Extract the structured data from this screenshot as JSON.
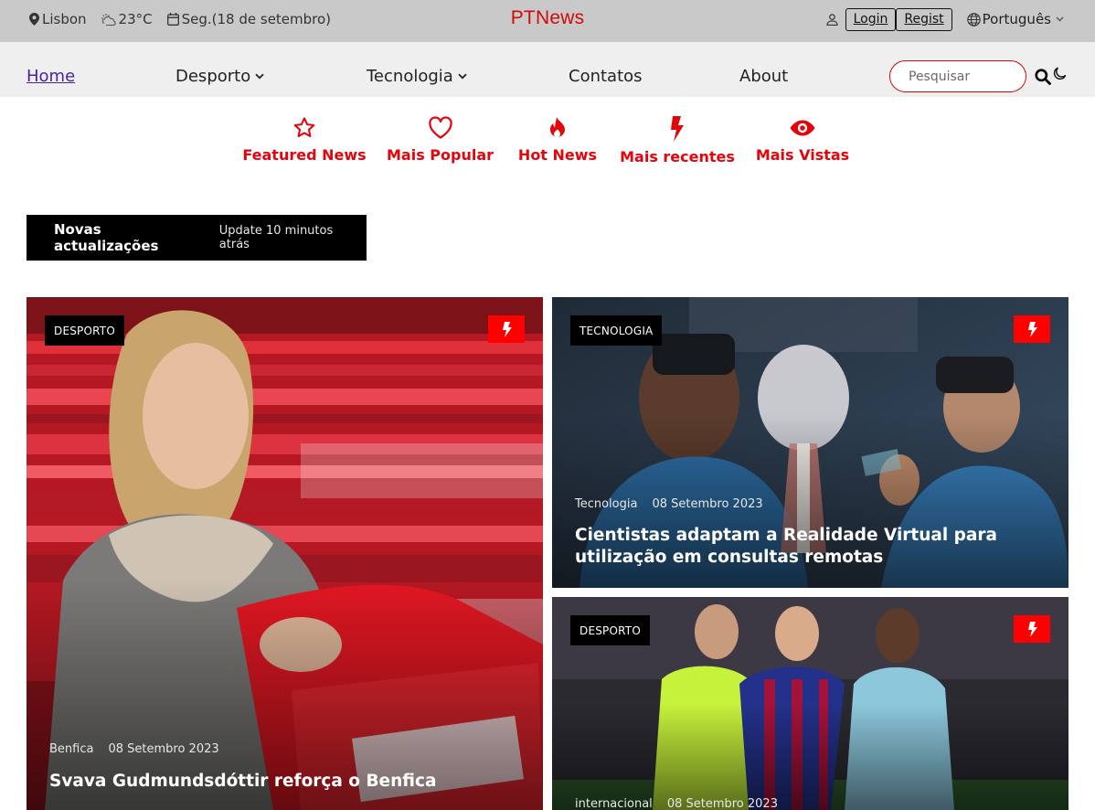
{
  "topbar": {
    "city": "Lisbon",
    "temperature": "23°C",
    "date": "Seg.(18 de setembro)",
    "brand": "PTNews",
    "login_label": "Login",
    "register_label": "Regist",
    "language": "Português"
  },
  "nav": {
    "home": "Home",
    "sports": "Desporto",
    "tech": "Tecnologia",
    "contacts": "Contatos",
    "about": "About",
    "search_placeholder": "Pesquisar"
  },
  "categories": [
    {
      "label": "Featured News",
      "icon": "star-icon"
    },
    {
      "label": "Mais Popular",
      "icon": "heart-icon"
    },
    {
      "label": "Hot News",
      "icon": "flame-icon"
    },
    {
      "label": "Mais recentes",
      "icon": "lightning-icon"
    },
    {
      "label": "Mais Vistas",
      "icon": "eye-icon"
    }
  ],
  "updates": {
    "title": "Novas actualizações",
    "subtitle": "Update 10 minutos atrás"
  },
  "articles": [
    {
      "tag": "DESPORTO",
      "category": "Benfica",
      "date": "08 Setembro 2023",
      "title": "Svava Gudmundsdóttir reforça o Benfica"
    },
    {
      "tag": "TECNOLOGIA",
      "category": "Tecnologia",
      "date": "08 Setembro 2023",
      "title": "Cientistas adaptam a Realidade Virtual para utilização em consultas remotas"
    },
    {
      "tag": "DESPORTO",
      "category": "internacional",
      "date": "08 Setembro 2023",
      "title": ""
    }
  ],
  "colors": {
    "accent": "#e3050b",
    "brand": "#d10a0a",
    "topbar": "#c9c9c9",
    "navbar": "#efefef"
  }
}
